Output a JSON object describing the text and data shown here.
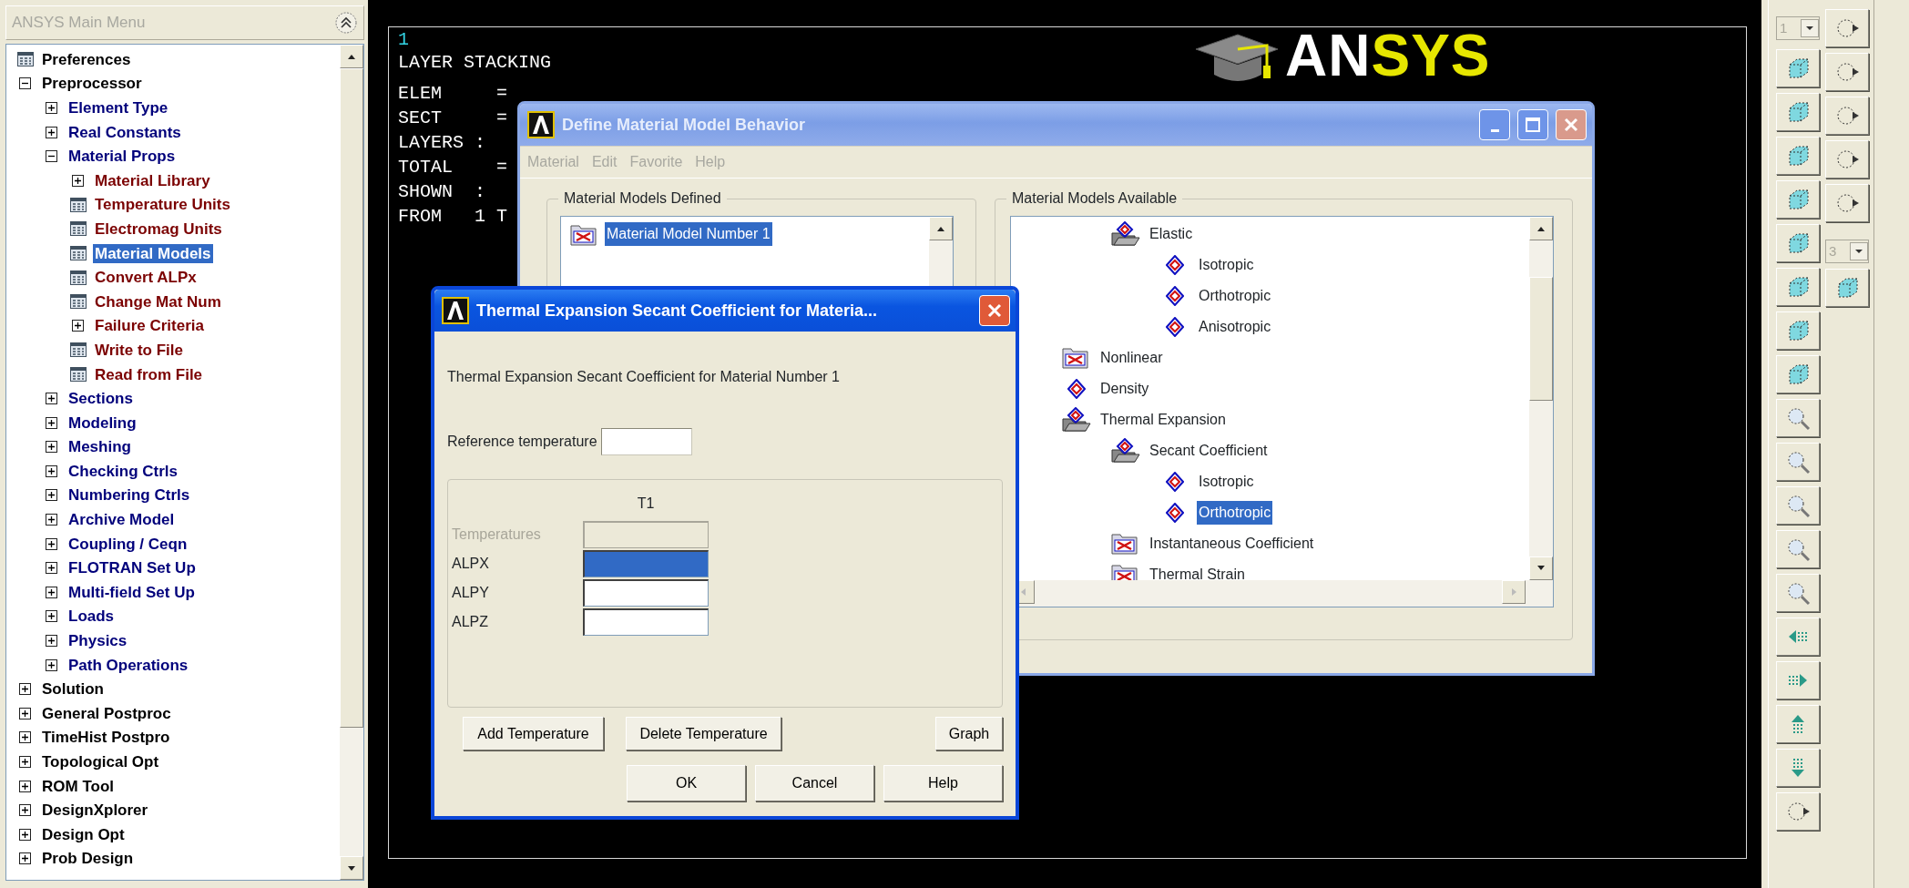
{
  "main_menu": {
    "title": "ANSYS Main Menu",
    "items": [
      {
        "label": "Preferences",
        "kind": "action",
        "selected": false
      },
      {
        "label": "Preprocessor",
        "kind": "folder",
        "expanded": true,
        "selected": false,
        "children": [
          {
            "label": "Element Type",
            "kind": "folder",
            "expanded": false,
            "selected": false
          },
          {
            "label": "Real Constants",
            "kind": "folder",
            "expanded": false,
            "selected": false
          },
          {
            "label": "Material Props",
            "kind": "folder",
            "expanded": true,
            "selected": false,
            "children": [
              {
                "label": "Material Library",
                "kind": "folder",
                "expanded": false,
                "selected": false
              },
              {
                "label": "Temperature Units",
                "kind": "action",
                "selected": false
              },
              {
                "label": "Electromag Units",
                "kind": "action",
                "selected": false
              },
              {
                "label": "Material Models",
                "kind": "action",
                "selected": true
              },
              {
                "label": "Convert ALPx",
                "kind": "action",
                "selected": false
              },
              {
                "label": "Change Mat Num",
                "kind": "action",
                "selected": false
              },
              {
                "label": "Failure Criteria",
                "kind": "folder",
                "expanded": false,
                "selected": false
              },
              {
                "label": "Write to File",
                "kind": "action",
                "selected": false
              },
              {
                "label": "Read from File",
                "kind": "action",
                "selected": false
              }
            ]
          },
          {
            "label": "Sections",
            "kind": "folder",
            "expanded": false,
            "selected": false
          },
          {
            "label": "Modeling",
            "kind": "folder",
            "expanded": false,
            "selected": false
          },
          {
            "label": "Meshing",
            "kind": "folder",
            "expanded": false,
            "selected": false
          },
          {
            "label": "Checking Ctrls",
            "kind": "folder",
            "expanded": false,
            "selected": false
          },
          {
            "label": "Numbering Ctrls",
            "kind": "folder",
            "expanded": false,
            "selected": false
          },
          {
            "label": "Archive Model",
            "kind": "folder",
            "expanded": false,
            "selected": false
          },
          {
            "label": "Coupling / Ceqn",
            "kind": "folder",
            "expanded": false,
            "selected": false
          },
          {
            "label": "FLOTRAN Set Up",
            "kind": "folder",
            "expanded": false,
            "selected": false
          },
          {
            "label": "Multi-field Set Up",
            "kind": "folder",
            "expanded": false,
            "selected": false
          },
          {
            "label": "Loads",
            "kind": "folder",
            "expanded": false,
            "selected": false
          },
          {
            "label": "Physics",
            "kind": "folder",
            "expanded": false,
            "selected": false
          },
          {
            "label": "Path Operations",
            "kind": "folder",
            "expanded": false,
            "selected": false
          }
        ]
      },
      {
        "label": "Solution",
        "kind": "folder",
        "expanded": false,
        "selected": false
      },
      {
        "label": "General Postproc",
        "kind": "folder",
        "expanded": false,
        "selected": false
      },
      {
        "label": "TimeHist Postpro",
        "kind": "folder",
        "expanded": false,
        "selected": false
      },
      {
        "label": "Topological Opt",
        "kind": "folder",
        "expanded": false,
        "selected": false
      },
      {
        "label": "ROM Tool",
        "kind": "folder",
        "expanded": false,
        "selected": false
      },
      {
        "label": "DesignXplorer",
        "kind": "folder",
        "expanded": false,
        "selected": false
      },
      {
        "label": "Design Opt",
        "kind": "folder",
        "expanded": false,
        "selected": false
      },
      {
        "label": "Prob Design",
        "kind": "folder",
        "expanded": false,
        "selected": false
      }
    ]
  },
  "graphics": {
    "window_number": "1",
    "heading": "LAYER STACKING",
    "lines": [
      "ELEM     =",
      "SECT     =",
      "LAYERS :",
      "TOTAL    =",
      "SHOWN  :",
      "FROM   1 T"
    ],
    "logo": {
      "part_1": "AN",
      "part_2": "SYS"
    }
  },
  "material_dialog": {
    "title": "Define Material Model Behavior",
    "active": false,
    "menu": [
      {
        "label": "Material",
        "disabled": true
      },
      {
        "label": "Edit",
        "disabled": true
      },
      {
        "label": "Favorite",
        "disabled": true
      },
      {
        "label": "Help",
        "disabled": true
      }
    ],
    "defined": {
      "title": "Material Models Defined",
      "items": [
        {
          "label": "Material Model Number 1",
          "selected": true
        }
      ]
    },
    "available": {
      "title": "Material Models Available",
      "tree": [
        {
          "children": [
            {
              "label": "Elastic",
              "kind": "group",
              "expanded": true,
              "selected": false,
              "children": [
                {
                  "label": "Isotropic",
                  "kind": "model",
                  "selected": false
                },
                {
                  "label": "Orthotropic",
                  "kind": "model",
                  "selected": false
                },
                {
                  "label": "Anisotropic",
                  "kind": "model",
                  "selected": false
                }
              ]
            }
          ]
        },
        {
          "label": "Nonlinear",
          "kind": "group",
          "expanded": false,
          "selected": false
        },
        {
          "label": "Density",
          "kind": "model",
          "selected": false
        },
        {
          "label": "Thermal Expansion",
          "kind": "group",
          "expanded": true,
          "selected": false,
          "children": [
            {
              "label": "Secant Coefficient",
              "kind": "group",
              "expanded": true,
              "selected": false,
              "children": [
                {
                  "label": "Isotropic",
                  "kind": "model",
                  "selected": false
                },
                {
                  "label": "Orthotropic",
                  "kind": "model",
                  "selected": true
                }
              ]
            },
            {
              "label": "Instantaneous Coefficient",
              "kind": "group",
              "expanded": false,
              "selected": false
            },
            {
              "label": "Thermal Strain",
              "kind": "group",
              "expanded": false,
              "selected": false
            }
          ]
        }
      ]
    }
  },
  "thermal_dialog": {
    "title": "Thermal Expansion Secant Coefficient for Materia...",
    "active": true,
    "description": "Thermal Expansion Secant Coefficient for Material Number 1",
    "reference_label": "Reference temperature",
    "column": "T1",
    "rows": [
      {
        "label": "Temperatures",
        "disabled": true,
        "selected": false
      },
      {
        "label": "ALPX",
        "disabled": false,
        "selected": true
      },
      {
        "label": "ALPY",
        "disabled": false,
        "selected": false
      },
      {
        "label": "ALPZ",
        "disabled": false,
        "selected": false
      }
    ],
    "table_buttons": [
      "Add Temperature",
      "Delete Temperature",
      "Graph"
    ],
    "buttons": [
      "OK",
      "Cancel",
      "Help"
    ]
  },
  "toolbar": {
    "dropdowns": [
      {
        "value": "1",
        "disabled": true
      },
      {
        "value": "3",
        "disabled": true
      }
    ]
  }
}
